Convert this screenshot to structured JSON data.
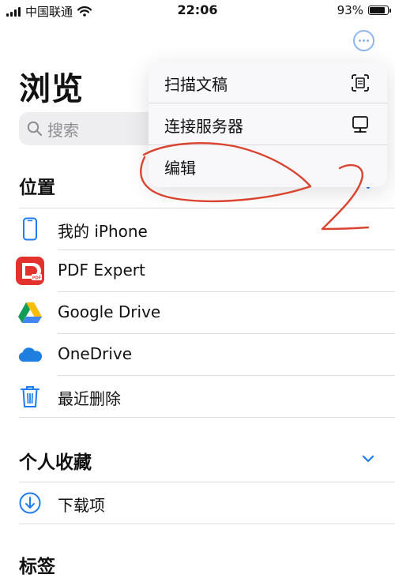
{
  "status_bar": {
    "carrier": "中国联通",
    "time": "22:06",
    "battery": "93%",
    "battery_fraction": 0.93
  },
  "header": {
    "title": "浏览"
  },
  "search": {
    "placeholder": "搜索"
  },
  "menu": {
    "items": [
      {
        "label": "扫描文稿",
        "icon": "scan-icon"
      },
      {
        "label": "连接服务器",
        "icon": "server-display-icon"
      },
      {
        "label": "编辑"
      }
    ]
  },
  "locations": {
    "title": "位置",
    "items": [
      {
        "label": "我的 iPhone",
        "icon": "iphone-icon"
      },
      {
        "label": "PDF Expert",
        "icon": "pdf-expert-icon"
      },
      {
        "label": "Google Drive",
        "icon": "google-drive-icon"
      },
      {
        "label": "OneDrive",
        "icon": "onedrive-icon"
      },
      {
        "label": "最近删除",
        "icon": "trash-icon"
      }
    ]
  },
  "favorites": {
    "title": "个人收藏",
    "items": [
      {
        "label": "下载项",
        "icon": "download-icon"
      }
    ]
  },
  "tags": {
    "title": "标签"
  },
  "colors": {
    "accent": "#1e7bf0",
    "annotation": "#d9432f",
    "pdf_red": "#e2322b",
    "onedrive_blue": "#1f7fe0"
  }
}
